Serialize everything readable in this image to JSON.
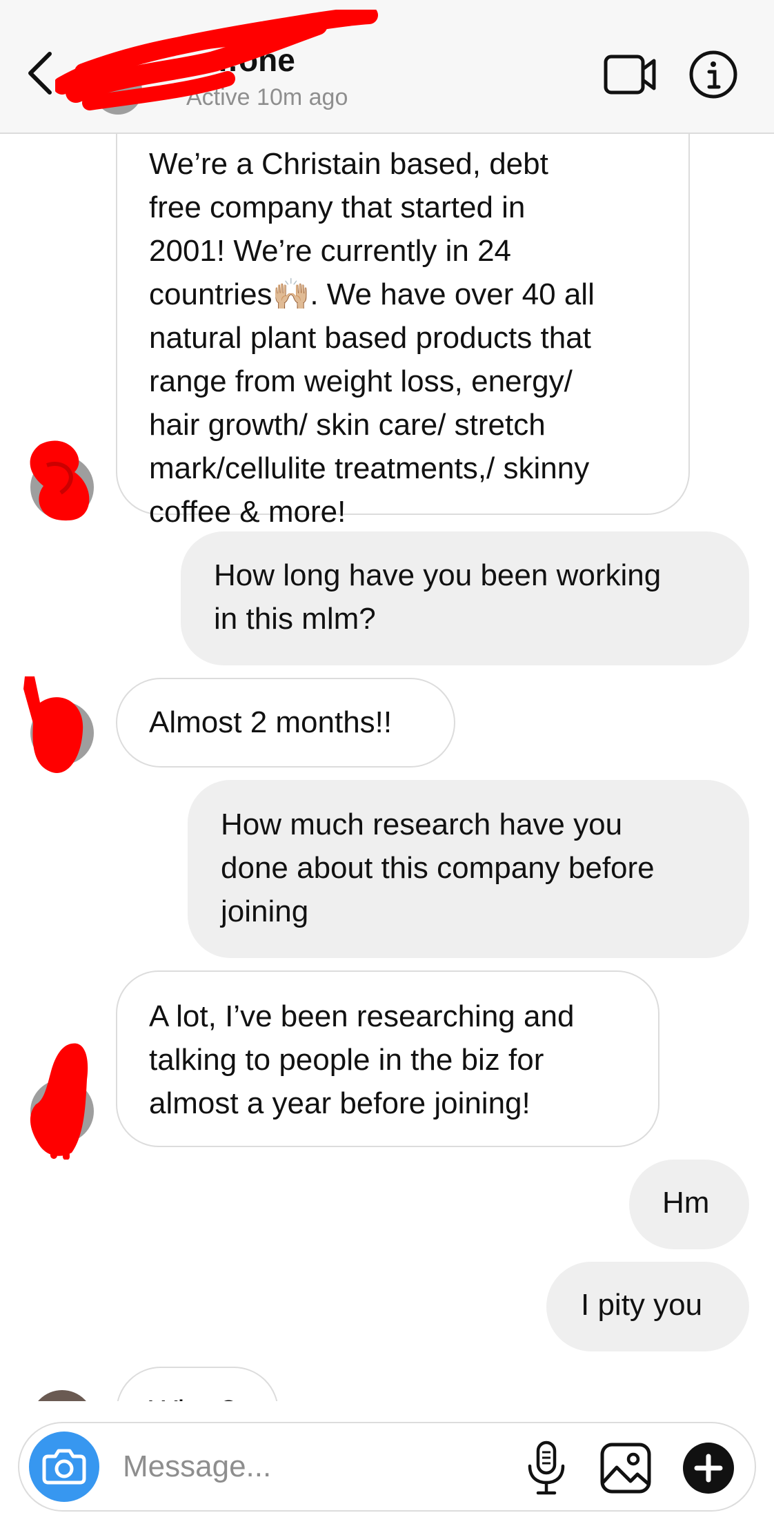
{
  "header": {
    "contact_name": "…one",
    "status": "Active 10m ago",
    "icons": {
      "back": "chevron-left-icon",
      "video": "video-camera-icon",
      "info": "info-icon"
    }
  },
  "messages": [
    {
      "direction": "incoming",
      "text": "We’re a Christain based, debt\nfree company that started in\n2001! We’re currently in 24\ncountries🙌🏼. We have over 40 all\nnatural plant based products that\nrange from weight loss, energy/\nhair growth/ skin care/ stretch\nmark/cellulite treatments,/ skinny\ncoffee & more!"
    },
    {
      "direction": "outgoing",
      "text": "How long have you been working\nin this mlm?"
    },
    {
      "direction": "incoming",
      "text": "Almost 2 months!!"
    },
    {
      "direction": "outgoing",
      "text": "How much research have you\ndone about this company before\njoining"
    },
    {
      "direction": "incoming",
      "text": "A lot, I’ve been researching and\ntalking to people in the biz for\nalmost a year before joining!"
    },
    {
      "direction": "outgoing",
      "text": "Hm"
    },
    {
      "direction": "outgoing",
      "text": "I pity you"
    },
    {
      "direction": "incoming",
      "text": "What?"
    }
  ],
  "composer": {
    "placeholder": "Message...",
    "icons": {
      "camera": "camera-icon",
      "mic": "microphone-icon",
      "gallery": "image-gallery-icon",
      "plus": "plus-icon"
    }
  },
  "colors": {
    "redaction": "#ff0000",
    "camera_button": "#3797f0",
    "outgoing_bubble": "#efefef",
    "incoming_border": "#dcdcdc",
    "header_bg": "#f7f7f7"
  }
}
